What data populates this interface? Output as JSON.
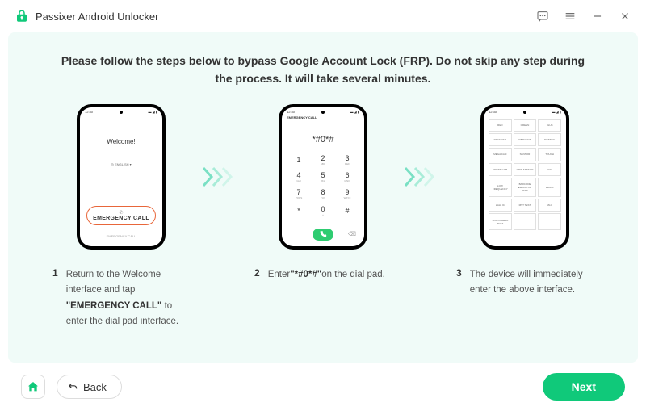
{
  "app": {
    "title": "Passixer Android Unlocker"
  },
  "heading": "Please follow the steps below to bypass Google Account Lock (FRP). Do not skip any step during the process. It will take several minutes.",
  "phone1": {
    "welcome": "Welcome!",
    "lang": "◎ ENGLISH ▾",
    "emergency": "EMERGENCY CALL",
    "emergency_small": "EMERGENCY CALL"
  },
  "phone2": {
    "title": "EMERGENCY CALL",
    "display": "*#0*#",
    "keys": [
      {
        "n": "1",
        "l": ""
      },
      {
        "n": "2",
        "l": "ABC"
      },
      {
        "n": "3",
        "l": "DEF"
      },
      {
        "n": "4",
        "l": "GHI"
      },
      {
        "n": "5",
        "l": "JKL"
      },
      {
        "n": "6",
        "l": "MNO"
      },
      {
        "n": "7",
        "l": "PQRS"
      },
      {
        "n": "8",
        "l": "TUV"
      },
      {
        "n": "9",
        "l": "WXYZ"
      },
      {
        "n": "*",
        "l": ""
      },
      {
        "n": "0",
        "l": "+"
      },
      {
        "n": "#",
        "l": ""
      }
    ]
  },
  "phone3": {
    "cells": [
      "RED",
      "GREEN",
      "BLUE",
      "RECEIVER",
      "VIBRATION",
      "DIMMING",
      "MEGA CAM",
      "SENSOR",
      "TOUCH",
      "FRONT CAM",
      "GRIP SENSOR",
      "LED",
      "LOW FREQUENCY",
      "BARCODE EMULATOR TEST",
      "BLACK",
      "HALL IC",
      "MST TEST",
      "MLC",
      "SUB CAMERA TEST",
      "",
      ""
    ]
  },
  "steps": {
    "s1": {
      "num": "1",
      "pre": "Return to the Welcome interface and tap ",
      "bold": "\"EMERGENCY CALL\"",
      "post": " to enter the dial pad interface."
    },
    "s2": {
      "num": "2",
      "pre": "Enter",
      "bold": "\"*#0*#\"",
      "post": "on the dial pad."
    },
    "s3": {
      "num": "3",
      "text": "The device will immediately enter the above interface."
    }
  },
  "footer": {
    "back": "Back",
    "next": "Next"
  }
}
